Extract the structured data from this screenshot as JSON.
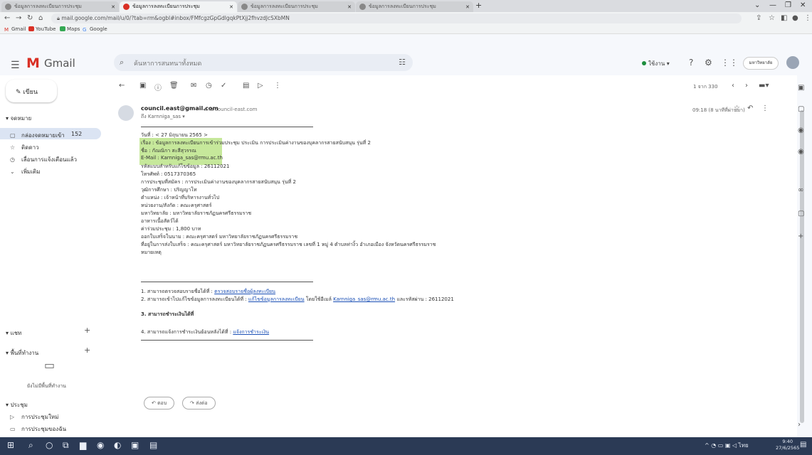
{
  "browser": {
    "tabs": [
      {
        "label": "ข้อมูลการลงทะเบียนการประชุม",
        "active": false
      },
      {
        "label": "ข้อมูลการลงทะเบียนการประชุม",
        "active": true
      },
      {
        "label": "ข้อมูลการลงทะเบียนการประชุม",
        "active": false
      },
      {
        "label": "ข้อมูลการลงทะเบียนการประชุม",
        "active": false
      }
    ],
    "url": "mail.google.com/mail/u/0/?tab=rm&ogbl#inbox/FMfcgzGpGdlgqkPtXjj2fhvzdJcSXbMN",
    "bookmarks": [
      "Gmail",
      "YouTube",
      "Maps",
      "Google"
    ]
  },
  "gmail": {
    "logo_letter": "M",
    "app_name": "Gmail",
    "search_placeholder": "ค้นหาการสนทนาทั้งหมด",
    "status": "ใช้งาน",
    "org_logo_text": "มหาวิทยาลัย",
    "compose_label": "เขียน",
    "mail_section": "จดหมาย",
    "inbox_label": "กล่องจดหมายเข้า",
    "inbox_count": "152",
    "starred_label": "ติดดาว",
    "snoozed_label": "เลื่อนการแจ้งเตือนแล้ว",
    "more_label": "เพิ่มเติม",
    "chat_label": "แชท",
    "spaces_label": "พื้นที่ทำงาน",
    "spaces_empty": "ยังไม่มีพื้นที่ทำงาน",
    "meet_label": "ประชุม",
    "meet_new": "การประชุมใหม่",
    "meet_join": "การประชุมของฉัน",
    "pager": "1 จาก 330"
  },
  "email": {
    "sender_email": "council.east@gmail.com",
    "sender_via": "ผ่าน council-east.com",
    "to_line": "ถึง Karnniga_sas ▾",
    "time": "09:18 (8 นาทีที่ผ่านมา)",
    "lines": {
      "date": "วันที่ : < 27 มิถุนายน 2565 >",
      "subject": "เรื่อง : ข้อมูลการลงทะเบียนการเข้าร่วมประชุม ประเมิน การประเมินค่างานของบุคลากรสายสนับสนุน รุ่นที่ 2",
      "name": "ชื่อ : กัณณิกา สะสีสุวรรณ",
      "email": "E-Mail : Karnniga_sas@rmu.ac.th",
      "ref": "รหัสแบบสำหรับแก้ไขข้อมูล : 26112021",
      "phone": "โทรศัพท์ : 0517370365",
      "course": "การประชุมที่สมัคร : การประเมินค่างานของบุคลากรสายสนับสนุน รุ่นที่ 2",
      "education": "วุฒิการศึกษา : ปริญญาโท",
      "position": "ตำแหน่ง : เจ้าหน้าที่บริหารงานทั่วไป",
      "unit": "หน่วยงาน/สังกัด : คณะครุศาสตร์",
      "university": "มหาวิทยาลัย : มหาวิทยาลัยราชภัฏนครศรีธรรมราช",
      "food": "อาหารเนื้อสัตว์ได้",
      "fee": "ค่าร่วมประชุม : 1,800 บาท",
      "receipt_name": "ออกใบเสร็จในนาม : คณะครุศาสตร์ มหาวิทยาลัยราชภัฏนครศรีธรรมราช",
      "address": "ที่อยู่ในการส่งใบเสร็จ : คณะครุศาสตร์ มหาวิทยาลัยราชภัฏนครศรีธรรมราช เลขที่ 1 หมู่ 4 ตำบลท่างิ้ว อำเภอเมือง จังหวัดนครศรีธรรมราช",
      "remark": "หมายเหตุ"
    },
    "footer": {
      "item1_prefix": "1. สามารถตรวจสอบรายชื่อได้ที่ :",
      "item1_link": "ตรวจสอบรายชื่อผู้ลงทะเบียน",
      "item2_prefix": "2. สามารถเข้าไปแก้ไขข้อมูลการลงทะเบียนได้ที่ :",
      "item2_link": "แก้ไขข้อมูลการลงทะเบียน",
      "item2_mid": "โดยใช้อีเมล์",
      "item2_email": "Karnniga_sas@rmu.ac.th",
      "item2_suffix": "และรหัสผ่าน : 26112021",
      "item3": "3. สามารถชำระเงินได้ที่",
      "item4_prefix": "4. สามารถแจ้งการชำระเงินย้อนหลังได้ที่ :",
      "item4_link": "แจ้งการชำระเงิน"
    },
    "reply_label": "ตอบ",
    "forward_label": "ส่งต่อ"
  },
  "taskbar": {
    "time": "9:40",
    "date": "27/6/2565",
    "lang": "ไทย"
  },
  "colors": {
    "highlight": "#c6e89b",
    "gmail_red": "#d93025",
    "inbox_selected": "#dbe4f3",
    "taskbar": "#2b3a55"
  }
}
